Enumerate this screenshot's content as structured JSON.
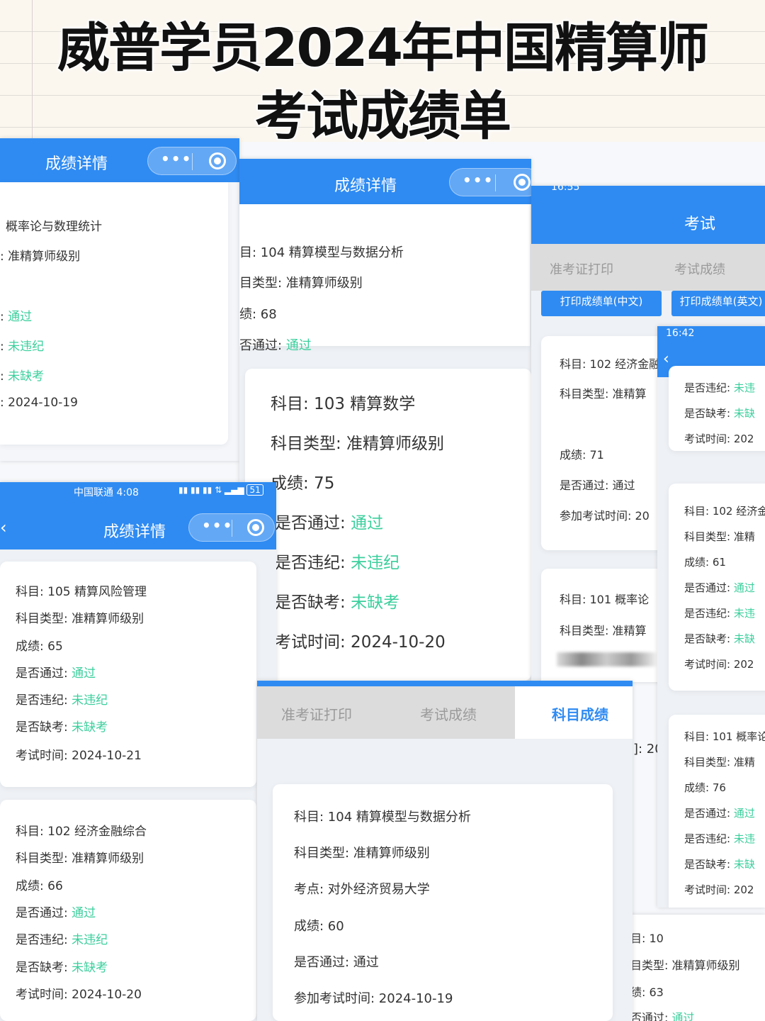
{
  "title": {
    "line1": "威普学员2024年中国精算师",
    "line2": "考试成绩单"
  },
  "shotA": {
    "header": "成绩详情",
    "rows": [
      "概率论与数理统计",
      ": 准精算师级别"
    ],
    "pass_prefix": ": ",
    "pass": "通过",
    "viol_prefix": ": ",
    "viol": "未违纪",
    "absent_prefix": ": ",
    "absent": "未缺考",
    "date": ": 2024-10-19"
  },
  "shotB": {
    "header": "成绩详情",
    "card1": {
      "subject": "目: 104 精算模型与数据分析",
      "type": "目类型: 准精算师级别",
      "score": "绩: 68",
      "pass_label": "否通过: ",
      "pass": "通过"
    },
    "card2": {
      "subject": "科目: 103 精算数学",
      "type": "科目类型: 准精算师级别",
      "score": "成绩: 75",
      "pass_label": "是否通过: ",
      "pass": "通过",
      "viol_label": "是否违纪: ",
      "viol": "未违纪",
      "absent_label": "是否缺考: ",
      "absent": "未缺考",
      "date": "考试时间:  2024-10-20"
    }
  },
  "shotC": {
    "status_time": "16:55",
    "header": "考试",
    "tabs": [
      "准考证打印",
      "考试成绩"
    ],
    "buttons": [
      "打印成绩单(中文)",
      "打印成绩单(英文)"
    ],
    "card1": {
      "subject": "科目: 102 经济金融",
      "type": "科目类型: 准精算",
      "score": "成绩: 71",
      "pass": "是否通过: 通过",
      "date": "参加考试时间: 20"
    },
    "card2": {
      "subject": "科目: 101 概率论",
      "type": "科目类型: 准精算"
    }
  },
  "shotD": {
    "status_time": "16:42",
    "card1": {
      "viol_label": "是否违纪: ",
      "viol": "未违",
      "absent_label": "是否缺考: ",
      "absent": "未缺",
      "date": "考试时间: 202"
    },
    "card2": {
      "subject": "科目: 102 经济金",
      "type": "科目类型: 准精",
      "score": "成绩: 61",
      "pass_label": "是否通过: ",
      "pass": "通过",
      "viol_label": "是否违纪: ",
      "viol": "未违",
      "absent_label": "是否缺考: ",
      "absent": "未缺",
      "date": "考试时间: 202"
    },
    "card3": {
      "subject": "科目: 101 概率论",
      "type": "科目类型: 准精",
      "score": "成绩: 76",
      "pass_label": "是否通过: ",
      "pass": "通过",
      "viol_label": "是否违纪: ",
      "viol": "未违",
      "absent_label": "是否缺考: ",
      "absent": "未缺",
      "date": "考试时间: 202"
    }
  },
  "shotE": {
    "status_carrier": "中国联通 4:08",
    "status_right": "51",
    "header": "成绩详情",
    "card1": {
      "subject": "科目: 105 精算风险管理",
      "type": "科目类型: 准精算师级别",
      "score": "成绩: 65",
      "pass_label": "是否通过: ",
      "pass": "通过",
      "viol_label": "是否违纪: ",
      "viol": "未违纪",
      "absent_label": "是否缺考: ",
      "absent": "未缺考",
      "date": "考试时间:  2024-10-21"
    },
    "card2": {
      "subject": "科目: 102 经济金融综合",
      "type": "科目类型: 准精算师级别",
      "score": "成绩: 66",
      "pass_label": "是否通过: ",
      "pass": "通过",
      "viol_label": "是否违纪: ",
      "viol": "未违纪",
      "absent_label": "是否缺考: ",
      "absent": "未缺考",
      "date": "考试时间:  2024-10-20"
    }
  },
  "shotF": {
    "tabs": [
      "准考证打印",
      "考试成绩",
      "科目成绩"
    ],
    "frag1": "过",
    "frag2": "]: 20",
    "card": {
      "subject": "科目: 104 精算模型与数据分析",
      "type": "科目类型:  准精算师级别",
      "site": "考点:  对外经济贸易大学",
      "score": "成绩:  60",
      "pass": "是否通过:  通过",
      "date": "参加考试时间:  2024-10-19"
    }
  },
  "shotG": {
    "subject": "目: 10",
    "type": "目类型: 准精算师级别",
    "score": "绩: 63",
    "pass_label": "否通过: ",
    "pass": "通过"
  }
}
